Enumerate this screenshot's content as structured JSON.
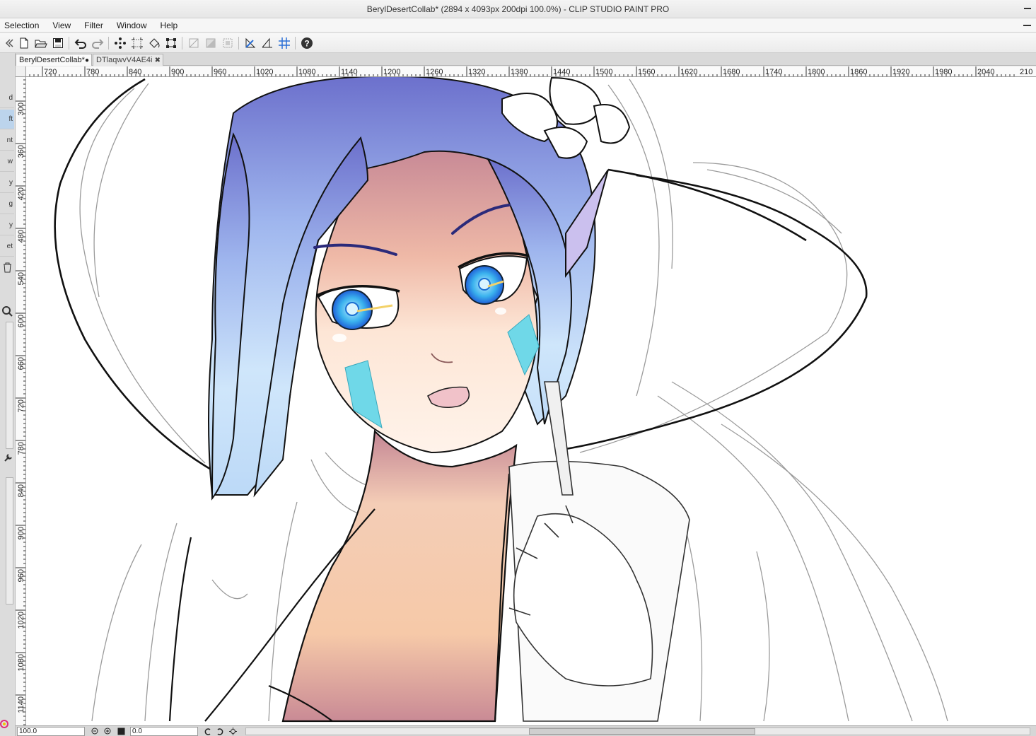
{
  "window": {
    "title": "BerylDesertCollab* (2894 x 4093px 200dpi 100.0%)  - CLIP STUDIO PAINT PRO"
  },
  "menu": {
    "items": [
      "Selection",
      "View",
      "Filter",
      "Window",
      "Help"
    ]
  },
  "toolbar": {
    "icons": [
      "new-file-icon",
      "open-file-icon",
      "save-icon",
      "undo-icon",
      "redo-icon",
      "clear-selection-icon",
      "crop-icon",
      "fill-icon",
      "transform-icon",
      "border-icon",
      "tone-icon",
      "selection-layer-icon",
      "ruler-icon",
      "perspective-ruler-icon",
      "grid-icon",
      "help-icon"
    ]
  },
  "left_panel": {
    "labels": [
      "d",
      "ft",
      "nt",
      "w",
      "y",
      "g",
      "y",
      "et"
    ]
  },
  "tabs": [
    {
      "label": "BerylDesertCollab*",
      "active": true
    },
    {
      "label": "DTlaqwvV4AE4i",
      "active": false
    }
  ],
  "rulers": {
    "horizontal": [
      "720",
      "780",
      "840",
      "900",
      "960",
      "1020",
      "1080",
      "1140",
      "1200",
      "1260",
      "1320",
      "1380",
      "1440",
      "1500",
      "1560",
      "1620",
      "1680",
      "1740",
      "1800",
      "1860",
      "1920",
      "1980",
      "2040",
      "210"
    ],
    "vertical": [
      "300",
      "360",
      "420",
      "480",
      "540",
      "600",
      "660",
      "720",
      "780",
      "840",
      "900",
      "960",
      "1020",
      "1080",
      "1140"
    ]
  },
  "status": {
    "zoom": "100.0",
    "rotation": "0.0"
  },
  "colors": {
    "hair_top": "#6b72cf",
    "hair_light": "#cfe6fb",
    "skin_warm": "#f6c9a8",
    "skin_shadow": "#c98a95",
    "eye": "#2aa7e8",
    "face_paint": "#6fd8e8",
    "line": "#111111",
    "sketch": "#8a8a8a"
  }
}
